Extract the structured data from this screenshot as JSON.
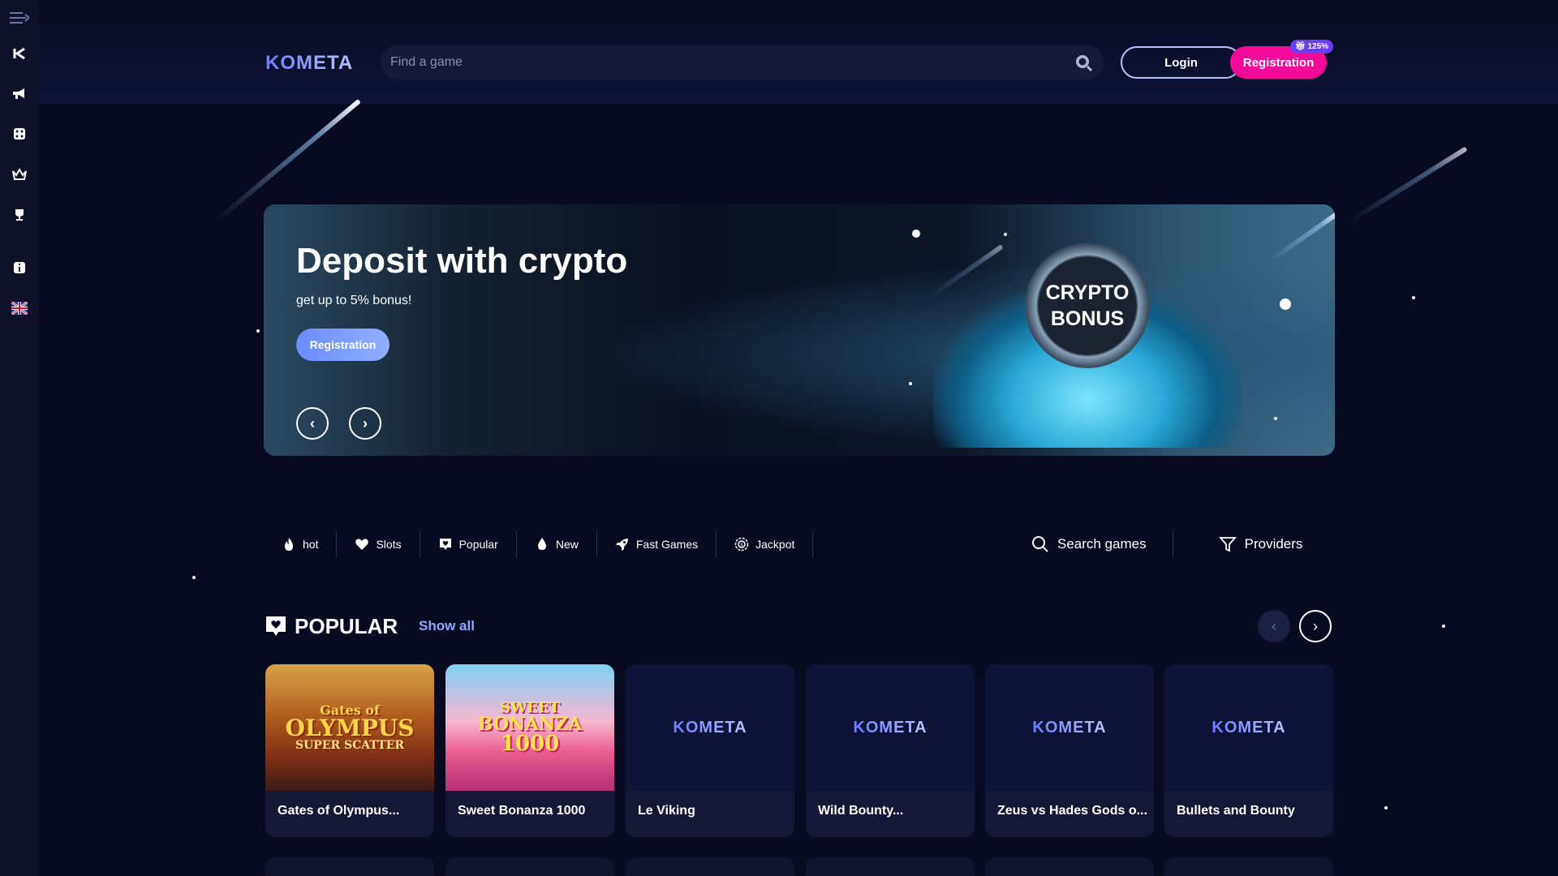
{
  "header": {
    "logo": "KOMETA",
    "search_placeholder": "Find a game",
    "login_label": "Login",
    "registration_label": "Registration",
    "registration_badge": "125%"
  },
  "sidebar": {
    "icons": [
      "menu-icon",
      "kometa-k-icon",
      "megaphone-icon",
      "dice-icon",
      "crown-icon",
      "trophy-icon",
      "info-icon",
      "uk-flag-icon"
    ]
  },
  "banner": {
    "title": "Deposit with crypto",
    "subtitle": "get up to 5% bonus!",
    "button_label": "Registration",
    "coin_line1": "CRYPTO",
    "coin_line2": "BONUS"
  },
  "categories": [
    {
      "label": "hot",
      "icon": "fire-icon"
    },
    {
      "label": "Slots",
      "icon": "heart-icon"
    },
    {
      "label": "Popular",
      "icon": "heart-badge-icon"
    },
    {
      "label": "New",
      "icon": "drop-icon"
    },
    {
      "label": "Fast Games",
      "icon": "rocket-icon"
    },
    {
      "label": "Jackpot",
      "icon": "jackpot-coin-icon"
    }
  ],
  "tools": {
    "search_label": "Search games",
    "providers_label": "Providers"
  },
  "popular": {
    "title": "POPULAR",
    "show_all": "Show all",
    "games": [
      {
        "name": "Gates of Olympus...",
        "art_line1": "Gates of",
        "art_line2": "OLYMPUS",
        "art_line3": "SUPER SCATTER"
      },
      {
        "name": "Sweet Bonanza 1000",
        "art_line1": "SWEET",
        "art_line2": "BONANZA",
        "art_line3": "1000"
      },
      {
        "name": "Le Viking",
        "placeholder": "KOMETA"
      },
      {
        "name": "Wild Bounty...",
        "placeholder": "KOMETA"
      },
      {
        "name": "Zeus vs Hades Gods o...",
        "placeholder": "KOMETA"
      },
      {
        "name": "Bullets and Bounty",
        "placeholder": "KOMETA"
      }
    ]
  },
  "colors": {
    "background": "#080a1f",
    "accent_pink": "#f20b9a",
    "accent_blue": "#8fa8ff"
  }
}
